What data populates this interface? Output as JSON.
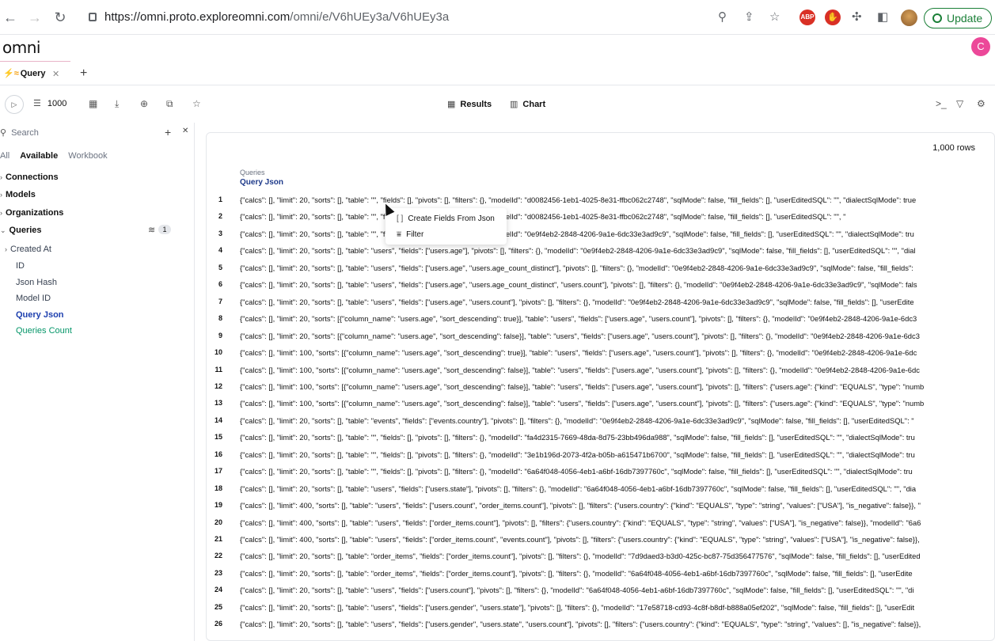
{
  "browser": {
    "url_host": "https://omni.proto.exploreomni.com",
    "url_path": "/omni/e/V6hUEy3a/V6hUEy3a",
    "abp_label": "ABP",
    "update_label": "Update"
  },
  "app": {
    "logo": "omni",
    "user_initial": "C"
  },
  "tabs": [
    {
      "label": "Query",
      "icon": "bolt-rainbow-icon"
    }
  ],
  "toolbar": {
    "limit": "1000",
    "results_label": "Results",
    "chart_label": "Chart"
  },
  "sidebar": {
    "search_placeholder": "Search",
    "filter_tabs": [
      "All",
      "Available",
      "Workbook"
    ],
    "active_filter": "Available",
    "sections": [
      "Connections",
      "Models",
      "Organizations",
      "Queries"
    ],
    "queries_badge": "1",
    "fields": [
      "Created At",
      "ID",
      "Json Hash",
      "Model ID",
      "Query Json",
      "Queries Count"
    ]
  },
  "results": {
    "row_count": "1,000 rows",
    "column_group": "Queries",
    "column_header": "Query Json",
    "rows": [
      {
        "n": "1",
        "json": "{\"calcs\": [], \"limit\": 20, \"sorts\": [], \"table\": \"\", \"fields\": [], \"pivots\": [], \"filters\": {}, \"modelId\": \"d0082456-1eb1-4025-8e31-ffbc062c2748\", \"sqlMode\": false, \"fill_fields\": [], \"userEditedSQL\": \"\", \"dialectSqlMode\": true"
      },
      {
        "n": "2",
        "json": "{\"calcs\": [], \"limit\": 20, \"sorts\": [], \"table\": \"\", \"fields\": [], \"pivots\": [], \"filters\": {}, \"modelId\": \"d0082456-1eb1-4025-8e31-ffbc062c2748\", \"sqlMode\": false, \"fill_fields\": [], \"userEditedSQL\": \"\", \""
      },
      {
        "n": "3",
        "json": "{\"calcs\": [], \"limit\": 20, \"sorts\": [], \"table\": \"\", \"fields\": [], \"pivots\": [], \"filters\": {}, \"modelId\": \"0e9f4eb2-2848-4206-9a1e-6dc33e3ad9c9\", \"sqlMode\": false, \"fill_fields\": [], \"userEditedSQL\": \"\", \"dialectSqlMode\": tru"
      },
      {
        "n": "4",
        "json": "{\"calcs\": [], \"limit\": 20, \"sorts\": [], \"table\": \"users\", \"fields\": [\"users.age\"], \"pivots\": [], \"filters\": {}, \"modelId\": \"0e9f4eb2-2848-4206-9a1e-6dc33e3ad9c9\", \"sqlMode\": false, \"fill_fields\": [], \"userEditedSQL\": \"\", \"dial"
      },
      {
        "n": "5",
        "json": "{\"calcs\": [], \"limit\": 20, \"sorts\": [], \"table\": \"users\", \"fields\": [\"users.age\", \"users.age_count_distinct\"], \"pivots\": [], \"filters\": {}, \"modelId\": \"0e9f4eb2-2848-4206-9a1e-6dc33e3ad9c9\", \"sqlMode\": false, \"fill_fields\":"
      },
      {
        "n": "6",
        "json": "{\"calcs\": [], \"limit\": 20, \"sorts\": [], \"table\": \"users\", \"fields\": [\"users.age\", \"users.age_count_distinct\", \"users.count\"], \"pivots\": [], \"filters\": {}, \"modelId\": \"0e9f4eb2-2848-4206-9a1e-6dc33e3ad9c9\", \"sqlMode\": fals"
      },
      {
        "n": "7",
        "json": "{\"calcs\": [], \"limit\": 20, \"sorts\": [], \"table\": \"users\", \"fields\": [\"users.age\", \"users.count\"], \"pivots\": [], \"filters\": {}, \"modelId\": \"0e9f4eb2-2848-4206-9a1e-6dc33e3ad9c9\", \"sqlMode\": false, \"fill_fields\": [], \"userEdite"
      },
      {
        "n": "8",
        "json": "{\"calcs\": [], \"limit\": 20, \"sorts\": [{\"column_name\": \"users.age\", \"sort_descending\": true}], \"table\": \"users\", \"fields\": [\"users.age\", \"users.count\"], \"pivots\": [], \"filters\": {}, \"modelId\": \"0e9f4eb2-2848-4206-9a1e-6dc3"
      },
      {
        "n": "9",
        "json": "{\"calcs\": [], \"limit\": 20, \"sorts\": [{\"column_name\": \"users.age\", \"sort_descending\": false}], \"table\": \"users\", \"fields\": [\"users.age\", \"users.count\"], \"pivots\": [], \"filters\": {}, \"modelId\": \"0e9f4eb2-2848-4206-9a1e-6dc3"
      },
      {
        "n": "10",
        "json": "{\"calcs\": [], \"limit\": 100, \"sorts\": [{\"column_name\": \"users.age\", \"sort_descending\": true}], \"table\": \"users\", \"fields\": [\"users.age\", \"users.count\"], \"pivots\": [], \"filters\": {}, \"modelId\": \"0e9f4eb2-2848-4206-9a1e-6dc"
      },
      {
        "n": "11",
        "json": "{\"calcs\": [], \"limit\": 100, \"sorts\": [{\"column_name\": \"users.age\", \"sort_descending\": false}], \"table\": \"users\", \"fields\": [\"users.age\", \"users.count\"], \"pivots\": [], \"filters\": {}, \"modelId\": \"0e9f4eb2-2848-4206-9a1e-6dc"
      },
      {
        "n": "12",
        "json": "{\"calcs\": [], \"limit\": 100, \"sorts\": [{\"column_name\": \"users.age\", \"sort_descending\": false}], \"table\": \"users\", \"fields\": [\"users.age\", \"users.count\"], \"pivots\": [], \"filters\": {\"users.age\": {\"kind\": \"EQUALS\", \"type\": \"numb"
      },
      {
        "n": "13",
        "json": "{\"calcs\": [], \"limit\": 100, \"sorts\": [{\"column_name\": \"users.age\", \"sort_descending\": false}], \"table\": \"users\", \"fields\": [\"users.age\", \"users.count\"], \"pivots\": [], \"filters\": {\"users.age\": {\"kind\": \"EQUALS\", \"type\": \"numb"
      },
      {
        "n": "14",
        "json": "{\"calcs\": [], \"limit\": 20, \"sorts\": [], \"table\": \"events\", \"fields\": [\"events.country\"], \"pivots\": [], \"filters\": {}, \"modelId\": \"0e9f4eb2-2848-4206-9a1e-6dc33e3ad9c9\", \"sqlMode\": false, \"fill_fields\": [], \"userEditedSQL\": \""
      },
      {
        "n": "15",
        "json": "{\"calcs\": [], \"limit\": 20, \"sorts\": [], \"table\": \"\", \"fields\": [], \"pivots\": [], \"filters\": {}, \"modelId\": \"fa4d2315-7669-48da-8d75-23bb496da988\", \"sqlMode\": false, \"fill_fields\": [], \"userEditedSQL\": \"\", \"dialectSqlMode\": tru"
      },
      {
        "n": "16",
        "json": "{\"calcs\": [], \"limit\": 20, \"sorts\": [], \"table\": \"\", \"fields\": [], \"pivots\": [], \"filters\": {}, \"modelId\": \"3e1b196d-2073-4f2a-b05b-a615471b6700\", \"sqlMode\": false, \"fill_fields\": [], \"userEditedSQL\": \"\", \"dialectSqlMode\": tru"
      },
      {
        "n": "17",
        "json": "{\"calcs\": [], \"limit\": 20, \"sorts\": [], \"table\": \"\", \"fields\": [], \"pivots\": [], \"filters\": {}, \"modelId\": \"6a64f048-4056-4eb1-a6bf-16db7397760c\", \"sqlMode\": false, \"fill_fields\": [], \"userEditedSQL\": \"\", \"dialectSqlMode\": tru"
      },
      {
        "n": "18",
        "json": "{\"calcs\": [], \"limit\": 20, \"sorts\": [], \"table\": \"users\", \"fields\": [\"users.state\"], \"pivots\": [], \"filters\": {}, \"modelId\": \"6a64f048-4056-4eb1-a6bf-16db7397760c\", \"sqlMode\": false, \"fill_fields\": [], \"userEditedSQL\": \"\", \"dia"
      },
      {
        "n": "19",
        "json": "{\"calcs\": [], \"limit\": 400, \"sorts\": [], \"table\": \"users\", \"fields\": [\"users.count\", \"order_items.count\"], \"pivots\": [], \"filters\": {\"users.country\": {\"kind\": \"EQUALS\", \"type\": \"string\", \"values\": [\"USA\"], \"is_negative\": false}}, \""
      },
      {
        "n": "20",
        "json": "{\"calcs\": [], \"limit\": 400, \"sorts\": [], \"table\": \"users\", \"fields\": [\"order_items.count\"], \"pivots\": [], \"filters\": {\"users.country\": {\"kind\": \"EQUALS\", \"type\": \"string\", \"values\": [\"USA\"], \"is_negative\": false}}, \"modelId\": \"6a6"
      },
      {
        "n": "21",
        "json": "{\"calcs\": [], \"limit\": 400, \"sorts\": [], \"table\": \"users\", \"fields\": [\"order_items.count\", \"events.count\"], \"pivots\": [], \"filters\": {\"users.country\": {\"kind\": \"EQUALS\", \"type\": \"string\", \"values\": [\"USA\"], \"is_negative\": false}},"
      },
      {
        "n": "22",
        "json": "{\"calcs\": [], \"limit\": 20, \"sorts\": [], \"table\": \"order_items\", \"fields\": [\"order_items.count\"], \"pivots\": [], \"filters\": {}, \"modelId\": \"7d9daed3-b3d0-425c-bc87-75d356477576\", \"sqlMode\": false, \"fill_fields\": [], \"userEdited"
      },
      {
        "n": "23",
        "json": "{\"calcs\": [], \"limit\": 20, \"sorts\": [], \"table\": \"order_items\", \"fields\": [\"order_items.count\"], \"pivots\": [], \"filters\": {}, \"modelId\": \"6a64f048-4056-4eb1-a6bf-16db7397760c\", \"sqlMode\": false, \"fill_fields\": [], \"userEdite"
      },
      {
        "n": "24",
        "json": "{\"calcs\": [], \"limit\": 20, \"sorts\": [], \"table\": \"users\", \"fields\": [\"users.count\"], \"pivots\": [], \"filters\": {}, \"modelId\": \"6a64f048-4056-4eb1-a6bf-16db7397760c\", \"sqlMode\": false, \"fill_fields\": [], \"userEditedSQL\": \"\", \"di"
      },
      {
        "n": "25",
        "json": "{\"calcs\": [], \"limit\": 20, \"sorts\": [], \"table\": \"users\", \"fields\": [\"users.gender\", \"users.state\"], \"pivots\": [], \"filters\": {}, \"modelId\": \"17e58718-cd93-4c8f-b8df-b888a05ef202\", \"sqlMode\": false, \"fill_fields\": [], \"userEdit"
      },
      {
        "n": "26",
        "json": "{\"calcs\": [], \"limit\": 20, \"sorts\": [], \"table\": \"users\", \"fields\": [\"users.gender\", \"users.state\", \"users.count\"], \"pivots\": [], \"filters\": {\"users.country\": {\"kind\": \"EQUALS\", \"type\": \"string\", \"values\": [], \"is_negative\": false}},"
      }
    ]
  },
  "context_menu": {
    "items": [
      "Create Fields From Json",
      "Filter"
    ]
  }
}
